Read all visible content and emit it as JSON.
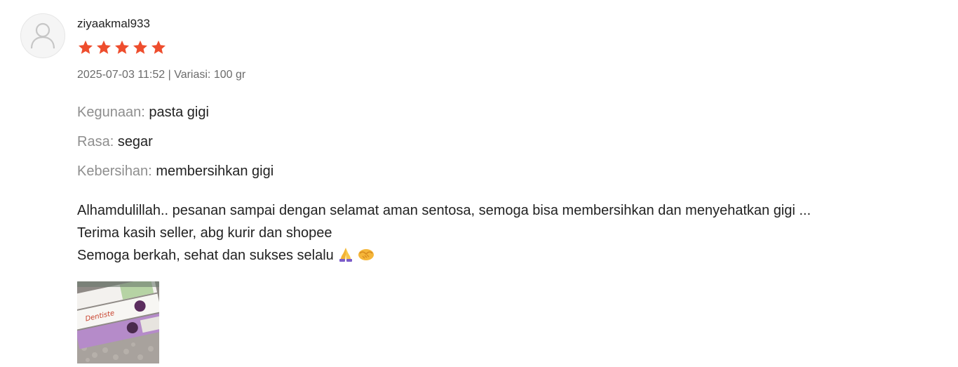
{
  "review": {
    "username": "ziyaakmal933",
    "rating": 5,
    "rating_max": 5,
    "star_color": "#ee4d2d",
    "date": "2025-07-03 11:52",
    "separator": "|",
    "variation_label": "Variasi:",
    "variation_value": "100 gr",
    "attributes": [
      {
        "label": "Kegunaan:",
        "value": "pasta gigi"
      },
      {
        "label": "Rasa:",
        "value": "segar"
      },
      {
        "label": "Kebersihan:",
        "value": "membersihkan gigi"
      }
    ],
    "comment_lines": [
      "Alhamdulillah.. pesanan sampai dengan selamat aman sentosa, semoga bisa membersihkan dan menyehatkan gigi ...",
      "Terima kasih seller, abg kurir dan shopee",
      "Semoga berkah, sehat dan sukses selalu"
    ],
    "comment_emojis": [
      "folded-hands-emoji",
      "handshake-emoji"
    ],
    "photo_logo_text": "Dentiste"
  }
}
